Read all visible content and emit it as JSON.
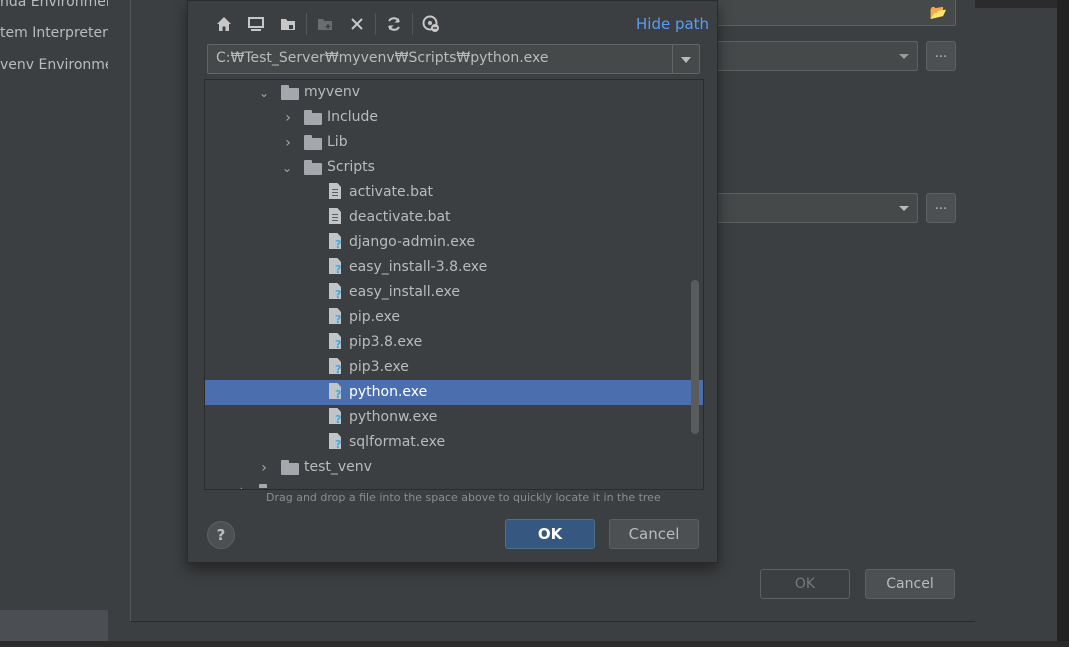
{
  "background": {
    "left_items": [
      "nda Environment",
      "tem Interpreter",
      "venv Environment"
    ],
    "ok_label": "OK",
    "cancel_label": "Cancel",
    "ellipsis": "..."
  },
  "dialog": {
    "toolbar": {
      "icons": [
        "home-icon",
        "desktop-icon",
        "project-folder-icon",
        "new-folder-icon",
        "delete-icon",
        "refresh-icon",
        "show-hidden-icon"
      ],
      "hide_path_label": "Hide path"
    },
    "path": "C:₩Test_Server₩myvenv₩Scripts₩python.exe",
    "tree": [
      {
        "label": "myvenv",
        "type": "folder",
        "expanded": true,
        "level": 0
      },
      {
        "label": "Include",
        "type": "folder",
        "expanded": false,
        "level": 1
      },
      {
        "label": "Lib",
        "type": "folder",
        "expanded": false,
        "level": 1
      },
      {
        "label": "Scripts",
        "type": "folder",
        "expanded": true,
        "level": 1
      },
      {
        "label": "activate.bat",
        "type": "text-file",
        "level": 2
      },
      {
        "label": "deactivate.bat",
        "type": "text-file",
        "level": 2
      },
      {
        "label": "django-admin.exe",
        "type": "unknown-file",
        "level": 2
      },
      {
        "label": "easy_install-3.8.exe",
        "type": "unknown-file",
        "level": 2
      },
      {
        "label": "easy_install.exe",
        "type": "unknown-file",
        "level": 2
      },
      {
        "label": "pip.exe",
        "type": "unknown-file",
        "level": 2
      },
      {
        "label": "pip3.8.exe",
        "type": "unknown-file",
        "level": 2
      },
      {
        "label": "pip3.exe",
        "type": "unknown-file",
        "level": 2
      },
      {
        "label": "python.exe",
        "type": "unknown-file",
        "level": 2,
        "selected": true
      },
      {
        "label": "pythonw.exe",
        "type": "unknown-file",
        "level": 2
      },
      {
        "label": "sqlformat.exe",
        "type": "unknown-file",
        "level": 2
      },
      {
        "label": "test_venv",
        "type": "folder",
        "expanded": false,
        "level": 0
      }
    ],
    "hint": "Drag and drop a file into the space above to quickly locate it in the tree",
    "help_label": "?",
    "ok_label": "OK",
    "cancel_label": "Cancel"
  },
  "colors": {
    "selection": "#4b6eaf",
    "link": "#589df6",
    "primary_button": "#365880",
    "background": "#3c3f41"
  }
}
